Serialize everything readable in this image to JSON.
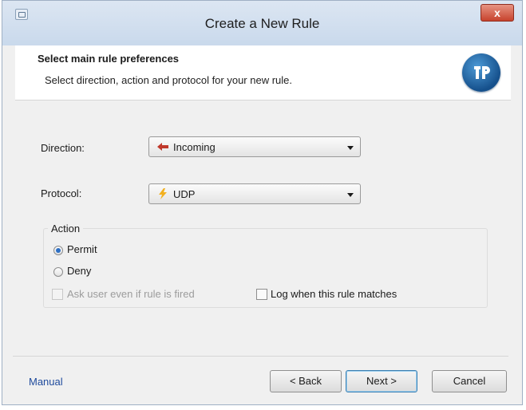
{
  "window": {
    "title": "Create a New Rule",
    "close_label": "x",
    "app_icon": "window-app-icon"
  },
  "header": {
    "title": "Select main rule preferences",
    "subtitle": "Select direction, action and protocol for your new rule.",
    "logo_icon": "brand-logo"
  },
  "form": {
    "direction": {
      "label": "Direction:",
      "value": "Incoming",
      "icon": "arrow-left-icon",
      "icon_color": "#c0392b"
    },
    "protocol": {
      "label": "Protocol:",
      "value": "UDP",
      "icon": "lightning-icon",
      "icon_color": "#f2b01e"
    },
    "action": {
      "group_label": "Action",
      "options": [
        {
          "label": "Permit",
          "checked": true
        },
        {
          "label": "Deny",
          "checked": false
        }
      ],
      "ask_user": {
        "label": "Ask user even if rule is fired",
        "checked": false,
        "enabled": false
      },
      "log_match": {
        "label": "Log when this rule matches",
        "checked": false,
        "enabled": true
      }
    }
  },
  "footer": {
    "manual_link": "Manual",
    "back_label": "< Back",
    "next_label": "Next >",
    "cancel_label": "Cancel"
  },
  "colors": {
    "accent": "#2d6fc4",
    "link": "#1e4a9c",
    "close": "#c7432d"
  }
}
